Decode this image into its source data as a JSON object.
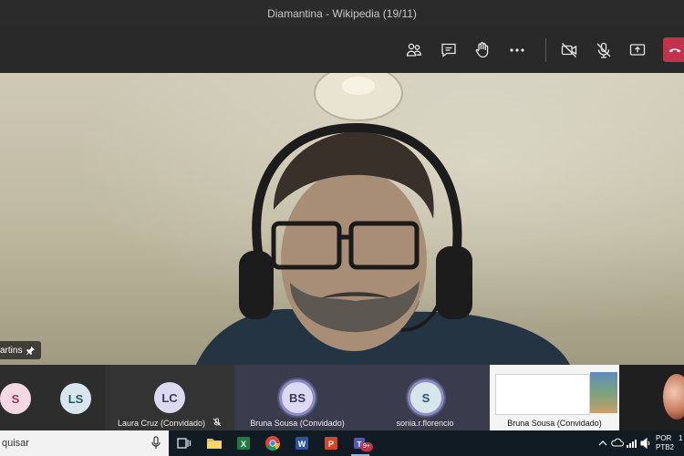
{
  "window": {
    "title": "Diamantina - Wikipedia (19/11)"
  },
  "toolbar": {
    "icons": [
      "participants-icon",
      "chat-icon",
      "raise-hand-icon",
      "more-options-icon",
      "camera-off-icon",
      "mic-off-icon",
      "share-screen-icon",
      "leave-call-icon"
    ],
    "leave_color": "#c4314b"
  },
  "main_video": {
    "participant_label": "artins"
  },
  "participants": [
    {
      "initials": "S",
      "name": "",
      "avatar_color": "#f4d9e4"
    },
    {
      "initials": "LS",
      "name": "",
      "avatar_color": "#d6e6ea"
    },
    {
      "initials": "LC",
      "name": "Laura Cruz (Convidado)",
      "avatar_color": "#dcd9f2"
    },
    {
      "initials": "BS",
      "name": "Bruna Sousa (Convidado)",
      "avatar_color": "#dcd9f2"
    },
    {
      "initials": "S",
      "name": "sonia.r.florencio",
      "avatar_color": "#d6e6ea"
    },
    {
      "initials": "",
      "name": "Bruna Sousa (Convidado)",
      "avatar_color": ""
    }
  ],
  "taskbar": {
    "search_text": "quisar",
    "apps": [
      "task-view-icon",
      "file-explorer-icon",
      "excel-icon",
      "chrome-icon",
      "word-icon",
      "powerpoint-icon",
      "teams-icon"
    ],
    "teams_badge": "9+",
    "language": "POR",
    "keyboard": "PTB2",
    "clock_partial": "1"
  }
}
